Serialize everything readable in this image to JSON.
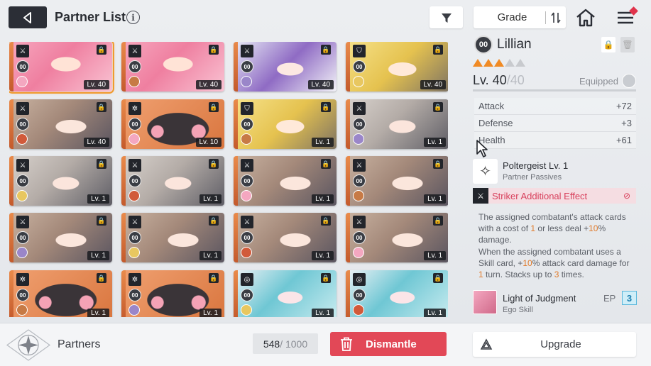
{
  "header": {
    "title": "Partner List",
    "info_glyph": "i",
    "grade_label": "Grade"
  },
  "cards": [
    {
      "level": "Lv. 40",
      "art": "pink",
      "type": "sword",
      "selected": true
    },
    {
      "level": "Lv. 40",
      "art": "pink",
      "type": "sword"
    },
    {
      "level": "Lv. 40",
      "art": "purple",
      "type": "sword"
    },
    {
      "level": "Lv. 40",
      "art": "blonde",
      "type": "shield"
    },
    {
      "level": "Lv. 40",
      "art": "brown",
      "type": "sword"
    },
    {
      "level": "Lv. 10",
      "art": "blob",
      "type": "gear"
    },
    {
      "level": "Lv. 1",
      "art": "blonde",
      "type": "shield"
    },
    {
      "level": "Lv. 1",
      "art": "silver",
      "type": "sword"
    },
    {
      "level": "Lv. 1",
      "art": "silver",
      "type": "sword"
    },
    {
      "level": "Lv. 1",
      "art": "silver",
      "type": "sword"
    },
    {
      "level": "Lv. 1",
      "art": "brown",
      "type": "sword"
    },
    {
      "level": "Lv. 1",
      "art": "brown",
      "type": "sword"
    },
    {
      "level": "Lv. 1",
      "art": "brown",
      "type": "sword"
    },
    {
      "level": "Lv. 1",
      "art": "brown",
      "type": "sword"
    },
    {
      "level": "Lv. 1",
      "art": "brown",
      "type": "sword"
    },
    {
      "level": "Lv. 1",
      "art": "brown",
      "type": "sword"
    },
    {
      "level": "Lv. 1",
      "art": "blob",
      "type": "gear"
    },
    {
      "level": "Lv. 1",
      "art": "blob",
      "type": "gear"
    },
    {
      "level": "Lv. 1",
      "art": "teal",
      "type": "target"
    },
    {
      "level": "Lv. 1",
      "art": "teal",
      "type": "target"
    }
  ],
  "oo_label": "00",
  "detail": {
    "name": "Lillian",
    "stars_total": 5,
    "stars_filled": 3,
    "level": "Lv. 40",
    "level_max": "/40",
    "equipped_label": "Equipped",
    "stats": [
      {
        "label": "Attack",
        "value": "+72"
      },
      {
        "label": "Defense",
        "value": "+3"
      },
      {
        "label": "Health",
        "value": "+61"
      }
    ],
    "passive_name": "Poltergeist Lv. 1",
    "passive_sub": "Partner Passives",
    "effect_label": "Striker Additional Effect",
    "desc": {
      "p1": "The assigned combatant's attack cards with a cost of ",
      "h1": "1",
      "p2": " or less deal +",
      "h2": "10",
      "p3": "% damage.",
      "p4": "When the assigned combatant uses a Skill card, +",
      "h3": "10",
      "p5": "% attack card damage for ",
      "h4": "1",
      "p6": " turn. Stacks up to ",
      "h5": "3",
      "p7": " times."
    },
    "ego_name": "Light of Judgment",
    "ego_sub": "Ego Skill",
    "ep_label": "EP",
    "ep_value": "3"
  },
  "footer": {
    "title": "Partners",
    "count": "548",
    "count_total": " / 1000",
    "dismantle_label": "Dismantle",
    "upgrade_label": "Upgrade"
  },
  "colors": {
    "accent_orange": "#f08a24",
    "dismantle_red": "#e24857",
    "effect_pink": "#d8405c",
    "dark": "#2b2e36"
  }
}
